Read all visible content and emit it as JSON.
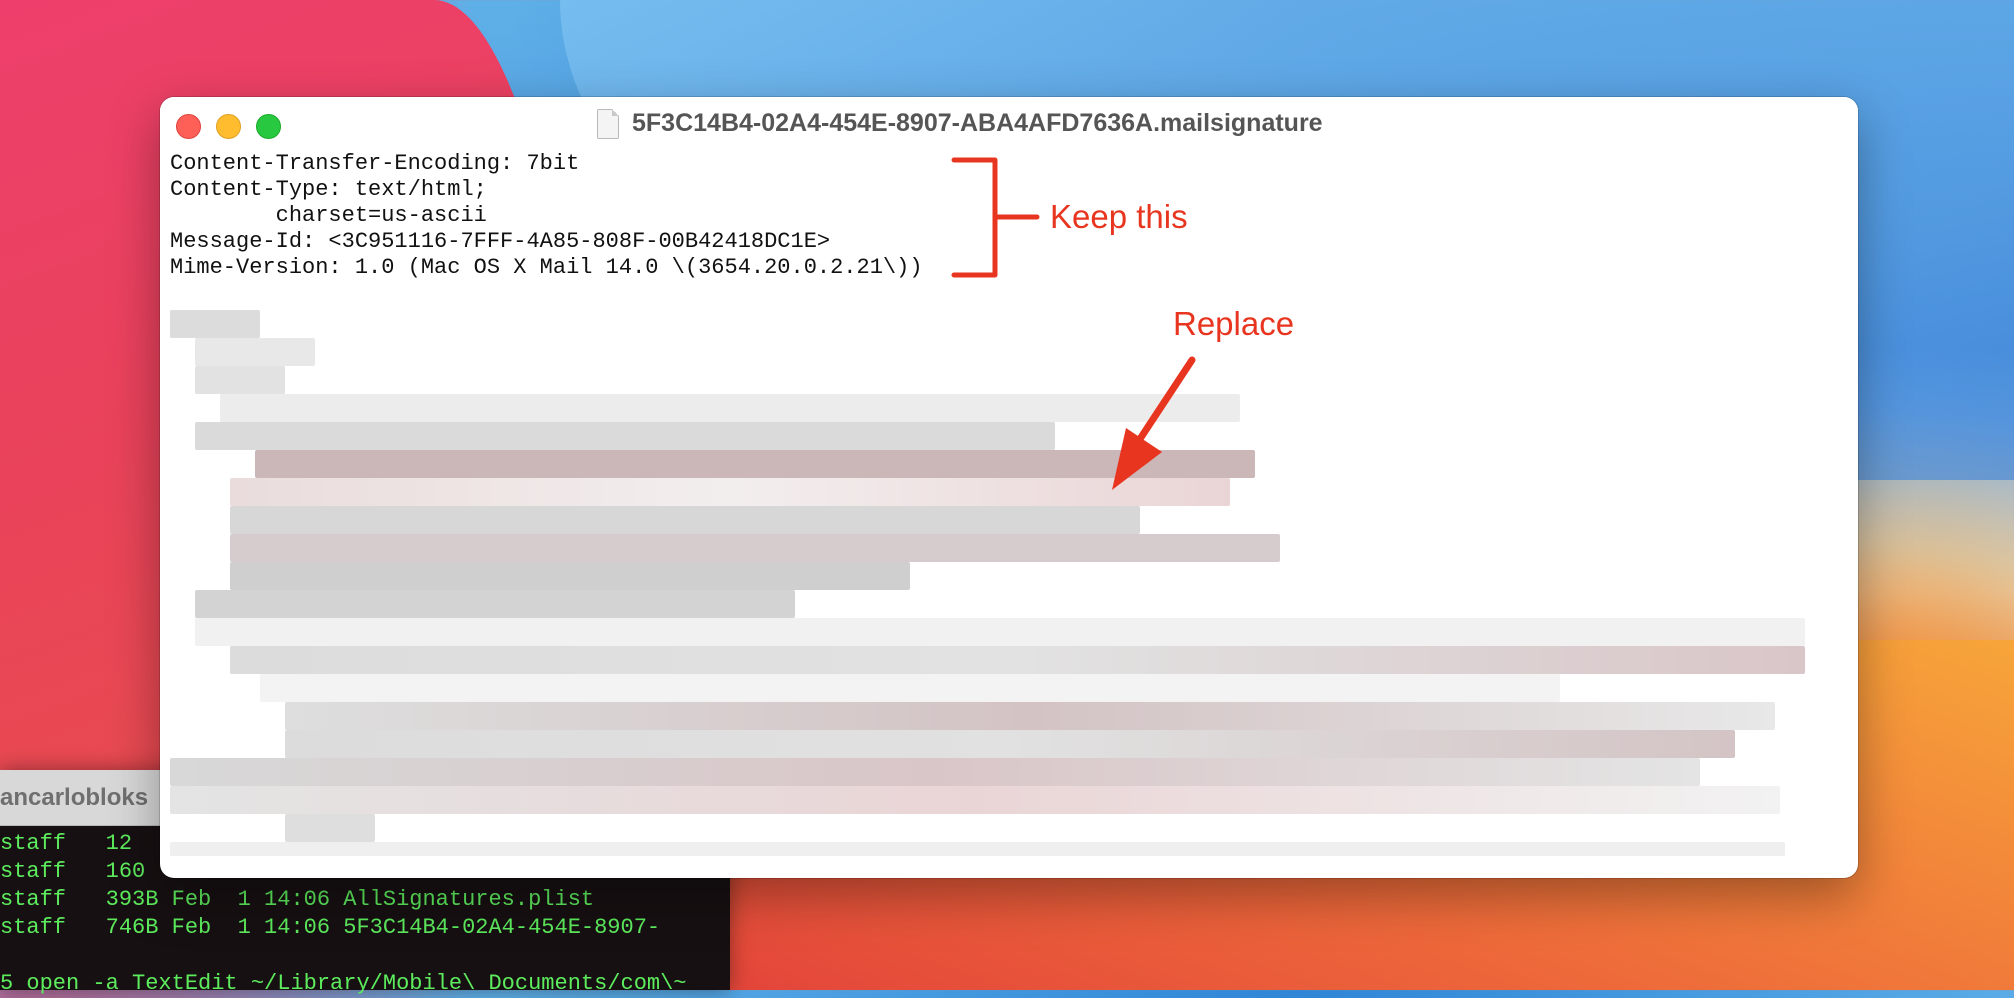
{
  "textedit_window": {
    "title": "5F3C14B4-02A4-454E-8907-ABA4AFD7636A.mailsignature",
    "header_lines": [
      "Content-Transfer-Encoding: 7bit",
      "Content-Type: text/html;",
      "        charset=us-ascii",
      "Message-Id: <3C951116-7FFF-4A85-808F-00B42418DC1E>",
      "Mime-Version: 1.0 (Mac OS X Mail 14.0 \\(3654.20.0.2.21\\))"
    ]
  },
  "annotations": {
    "keep_label": "Keep this",
    "replace_label": "Replace",
    "color": "#e8351f"
  },
  "terminal": {
    "title": "ancarlobloks",
    "lines": [
      "staff   12",
      "staff   160",
      "staff   393B Feb  1 14:06 AllSignatures.plist",
      "staff   746B Feb  1 14:06 5F3C14B4-02A4-454E-8907-",
      "",
      "5 open -a TextEdit ~/Library/Mobile\\ Documents/com\\~"
    ],
    "text_color": "#5dec5d"
  }
}
